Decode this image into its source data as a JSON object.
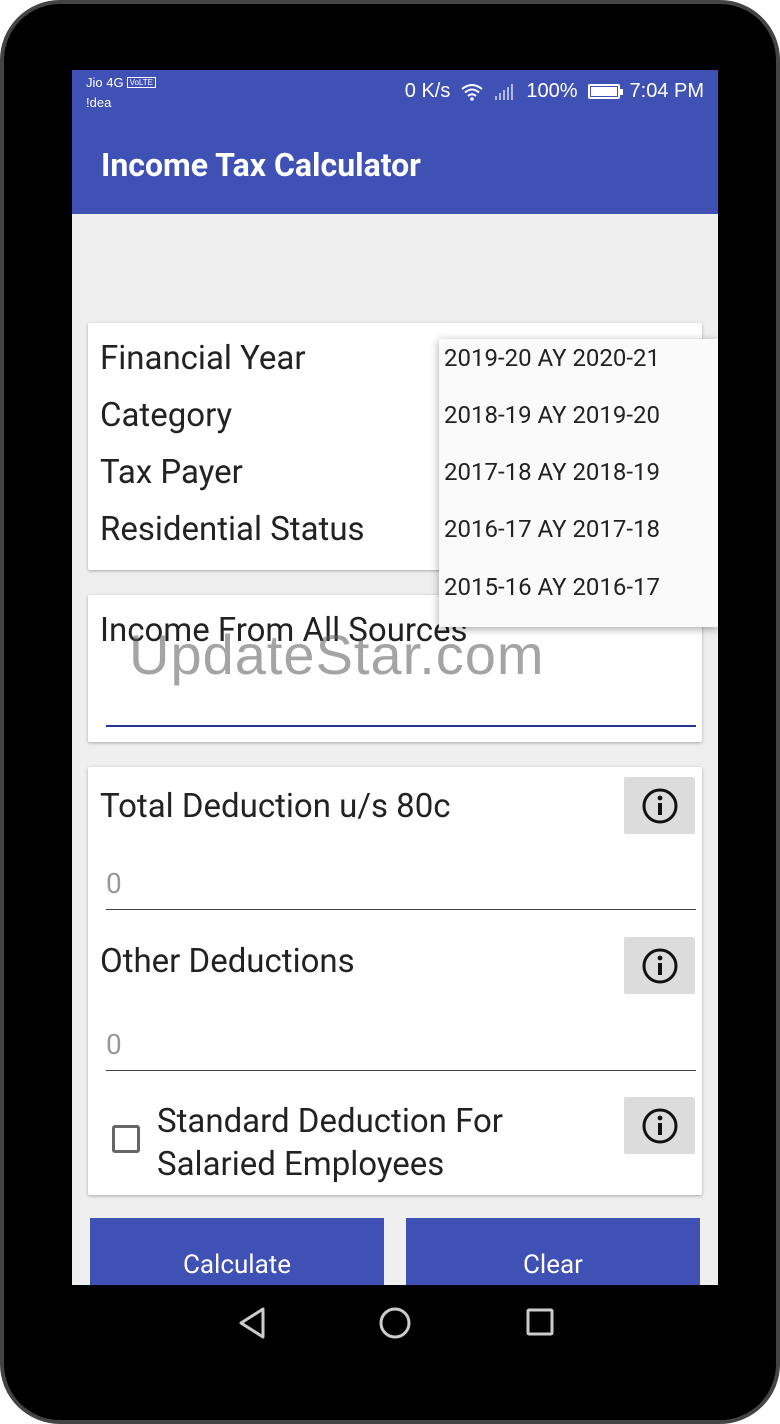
{
  "status_bar": {
    "carrier_primary": "Jio 4G",
    "volte_badge": "VoLTE",
    "carrier_secondary": "!dea",
    "network_speed": "0 K/s",
    "battery_percent": "100%",
    "battery_level": 1.0,
    "time": "7:04 PM"
  },
  "app_bar": {
    "title": "Income Tax Calculator"
  },
  "settings_card": {
    "labels": [
      "Financial Year",
      "Category",
      "Tax Payer",
      "Residential Status"
    ]
  },
  "year_dropdown": {
    "options": [
      "2019-20 AY 2020-21",
      "2018-19 AY 2019-20",
      "2017-18 AY 2018-19",
      "2016-17 AY 2017-18",
      "2015-16 AY 2016-17"
    ]
  },
  "income_card": {
    "label": "Income From All Sources"
  },
  "deductions_card": {
    "deduction_80c_label": "Total Deduction u/s 80c",
    "deduction_80c_value": "0",
    "other_deductions_label": "Other Deductions",
    "other_deductions_value": "0",
    "standard_deduction_label_line1": "Standard Deduction For",
    "standard_deduction_label_line2": "Salaried Employees",
    "standard_deduction_checked": false
  },
  "buttons": {
    "calculate": "Calculate",
    "clear": "Clear"
  },
  "watermark": "UpdateStar.com",
  "colors": {
    "primary": "#3f51b5",
    "accent_underline": "#283593"
  }
}
